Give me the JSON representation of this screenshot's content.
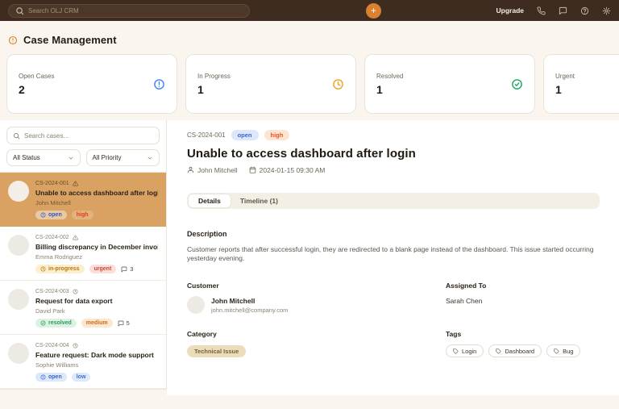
{
  "topbar": {
    "search_placeholder": "Search OLJ CRM",
    "add_label": "+",
    "upgrade_label": "Upgrade"
  },
  "page": {
    "title": "Case Management"
  },
  "stats": [
    {
      "label": "Open Cases",
      "value": "2",
      "icon": "alert-circle",
      "color": "#3B82F6"
    },
    {
      "label": "In Progress",
      "value": "1",
      "icon": "clock",
      "color": "#F0A11C"
    },
    {
      "label": "Resolved",
      "value": "1",
      "icon": "check-circle",
      "color": "#19A564"
    },
    {
      "label": "Urgent",
      "value": "1",
      "icon": "alert-triangle",
      "color": "#EF4444"
    }
  ],
  "sidebar": {
    "search_placeholder": "Search cases...",
    "filters": {
      "status": "All Status",
      "priority": "All Priority"
    },
    "cases": [
      {
        "id": "CS-2024-001",
        "title": "Unable to access dashboard after login",
        "customer": "John Mitchell",
        "status": "open",
        "priority": "high",
        "selected": true
      },
      {
        "id": "CS-2024-002",
        "title": "Billing discrepancy in December invoice",
        "customer": "Emma Rodriguez",
        "status": "in-progress",
        "priority": "urgent",
        "comments": "3"
      },
      {
        "id": "CS-2024-003",
        "title": "Request for data export",
        "customer": "David Park",
        "status": "resolved",
        "priority": "medium",
        "comments": "5"
      },
      {
        "id": "CS-2024-004",
        "title": "Feature request: Dark mode support",
        "customer": "Sophie Williams",
        "status": "open",
        "priority": "low"
      }
    ]
  },
  "detail": {
    "id": "CS-2024-001",
    "status": "open",
    "priority": "high",
    "title": "Unable to access dashboard after login",
    "reporter": "John Mitchell",
    "datetime": "2024-01-15 09:30 AM",
    "tabs": {
      "details": "Details",
      "timeline": "Timeline (1)"
    },
    "description_label": "Description",
    "description": "Customer reports that after successful login, they are redirected to a blank page instead of the dashboard. This issue started occurring yesterday evening.",
    "customer_label": "Customer",
    "customer_name": "John Mitchell",
    "customer_email": "john.mitchell@company.com",
    "assigned_label": "Assigned To",
    "assigned_to": "Sarah Chen",
    "category_label": "Category",
    "category": "Technical Issue",
    "tags_label": "Tags",
    "tags": [
      "Login",
      "Dashboard",
      "Bug"
    ]
  }
}
